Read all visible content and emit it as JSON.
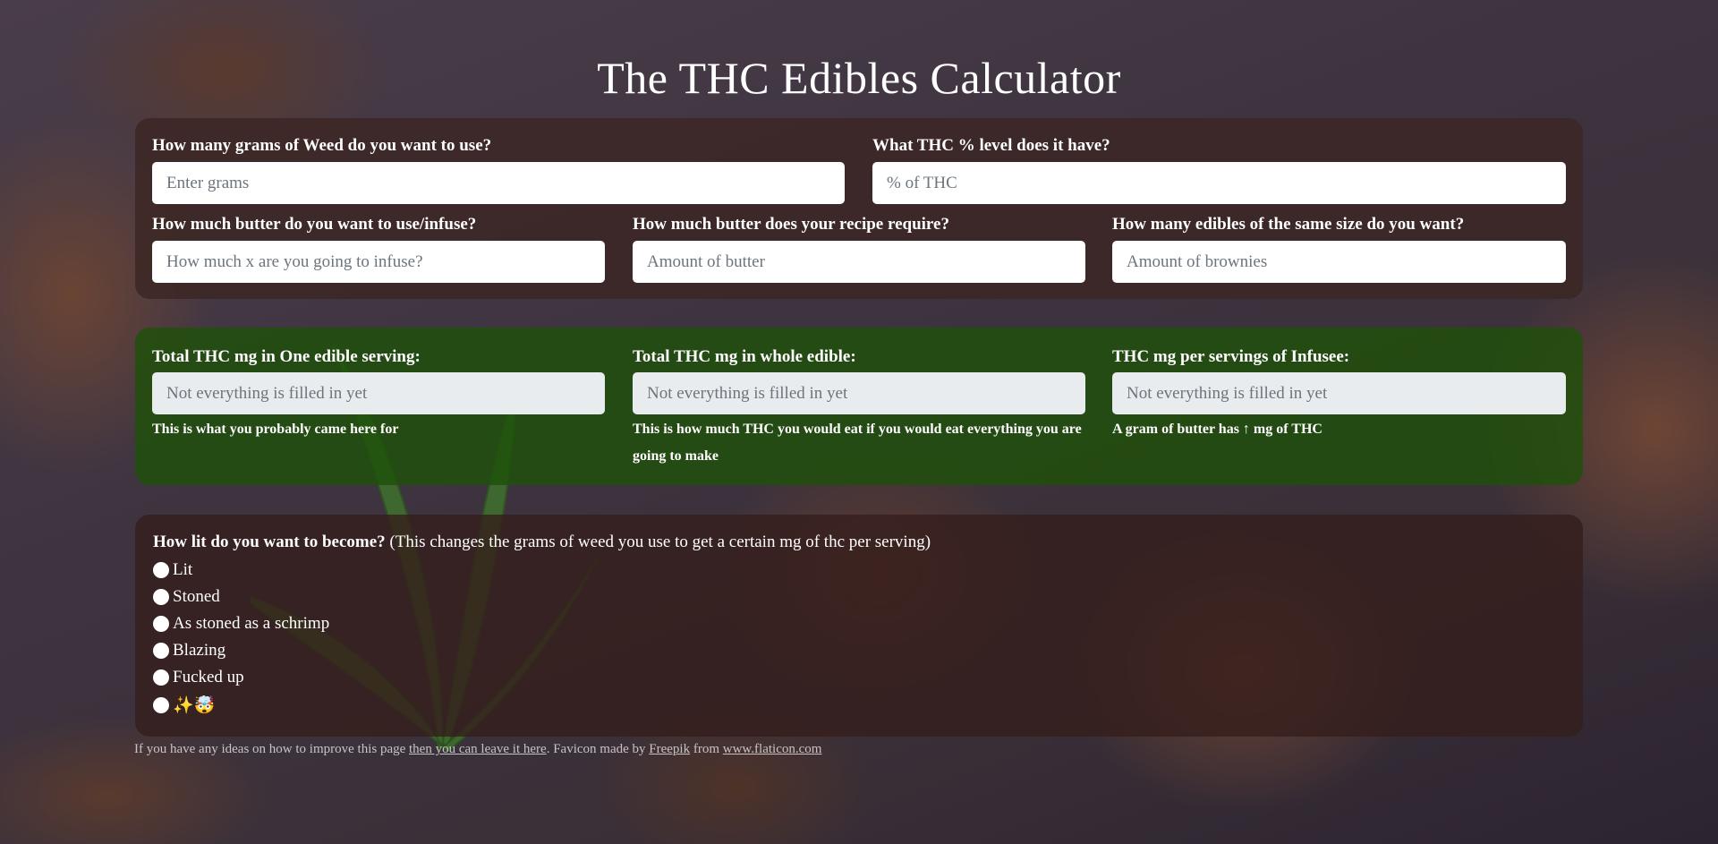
{
  "title": "The THC Edibles Calculator",
  "inputs": {
    "grams": {
      "label": "How many grams of Weed do you want to use?",
      "placeholder": "Enter grams",
      "value": ""
    },
    "thc": {
      "label": "What THC % level does it have?",
      "placeholder": "% of THC",
      "value": ""
    },
    "infuse": {
      "label": "How much butter do you want to use/infuse?",
      "placeholder": "How much x are you going to infuse?",
      "value": ""
    },
    "recipe": {
      "label": "How much butter does your recipe require?",
      "placeholder": "Amount of butter",
      "value": ""
    },
    "edibles": {
      "label": "How many edibles of the same size do you want?",
      "placeholder": "Amount of brownies",
      "value": ""
    }
  },
  "results": {
    "serving": {
      "label": "Total THC mg in One edible serving:",
      "placeholder": "Not everything is filled in yet",
      "help": "This is what you probably came here for"
    },
    "whole": {
      "label": "Total THC mg in whole edible:",
      "placeholder": "Not everything is filled in yet",
      "help": "This is how much THC you would eat if you would eat everything you are going to make"
    },
    "infusee": {
      "label": "THC mg per servings of Infusee:",
      "placeholder": "Not everything is filled in yet",
      "help": "A gram of butter has ↑ mg of THC"
    }
  },
  "lit": {
    "question_bold": "How lit do you want to become?",
    "question_rest": " (This changes the grams of weed you use to get a certain mg of thc per serving)",
    "options": [
      "Lit",
      "Stoned",
      "As stoned as a schrimp",
      "Blazing",
      "Fucked up",
      "✨🤯"
    ]
  },
  "footer": {
    "text1": "If you have any ideas on how to improve this page ",
    "link1": "then you can leave it here",
    "text2": ". Favicon made by ",
    "link2": "Freepik",
    "text3": " from ",
    "link3": "www.flaticon.com"
  },
  "colors": {
    "result_panel": "#1e500a",
    "input_panel": "#3c2623"
  }
}
